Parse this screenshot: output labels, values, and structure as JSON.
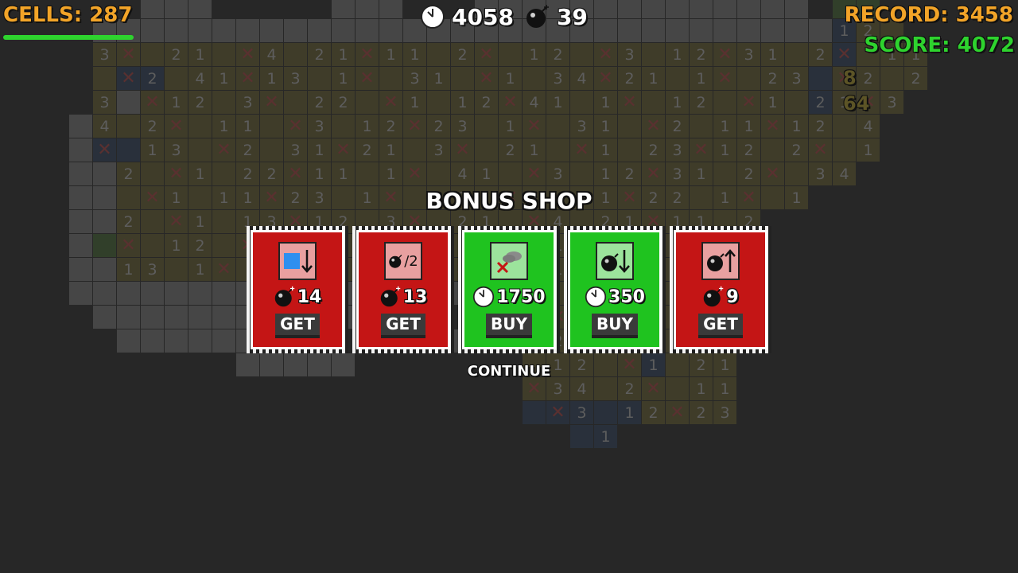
{
  "hud": {
    "cells_label": "CELLS: 287",
    "time_value": "4058",
    "bombs_value": "39",
    "record_label": "RECORD: 3458",
    "score_label": "SCORE: 4072",
    "side_a": "8",
    "side_b": "64"
  },
  "shop": {
    "title": "BONUS SHOP",
    "continue_label": "CONTINUE",
    "items": [
      {
        "icon": "blue-square-down-arrow-icon",
        "currency": "bomb",
        "price": "14",
        "action": "GET",
        "color": "red"
      },
      {
        "icon": "bomb-half-icon",
        "glyph": "/2",
        "currency": "bomb",
        "price": "13",
        "action": "GET",
        "color": "red"
      },
      {
        "icon": "cloud-cross-icon",
        "currency": "clock",
        "price": "1750",
        "action": "BUY",
        "color": "green"
      },
      {
        "icon": "bomb-down-arrow-icon",
        "currency": "clock",
        "price": "350",
        "action": "BUY",
        "color": "green"
      },
      {
        "icon": "bomb-up-arrow-icon",
        "currency": "bomb",
        "price": "9",
        "action": "GET",
        "color": "red"
      }
    ]
  },
  "colors": {
    "orange": "#f2a428",
    "green": "#2ed32e",
    "card_red": "#c41515",
    "card_green": "#1fc31f"
  }
}
